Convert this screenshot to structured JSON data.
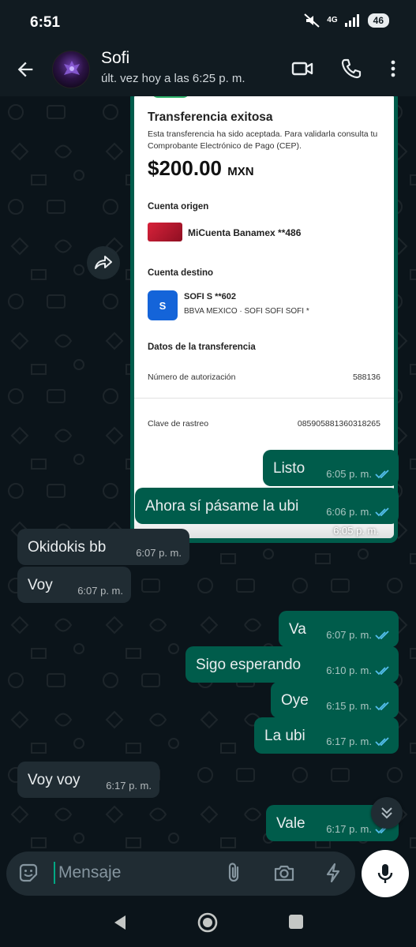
{
  "status_bar": {
    "time": "6:51",
    "network": "4G",
    "battery": "46"
  },
  "header": {
    "contact_name": "Sofi",
    "last_seen": "últ. vez hoy a las 6:25 p. m.",
    "icons": [
      "back-arrow-icon",
      "video-call-icon",
      "phone-icon",
      "more-vertical-icon"
    ]
  },
  "receipt": {
    "title": "Transferencia exitosa",
    "description": "Esta transferencia ha sido aceptada. Para validarla consulta tu Comprobante Electrónico de Pago (CEP).",
    "amount": "$200.00",
    "currency": "MXN",
    "origin_label": "Cuenta origen",
    "origin_account": "MiCuenta Banamex **486",
    "dest_label": "Cuenta destino",
    "dest_logo": "S",
    "dest_name": "SOFI S **602",
    "dest_detail": "BBVA MEXICO · SOFI SOFI SOFI *",
    "details_label": "Datos de la transferencia",
    "auth_label": "Número de autorización",
    "auth_value": "588136",
    "tracking_label": "Clave de rastreo",
    "tracking_value": "085905881360318265",
    "time": "6:05 p. m."
  },
  "messages": [
    {
      "dir": "out",
      "text": "Listo",
      "time": "6:05 p. m."
    },
    {
      "dir": "out",
      "text": "Ahora sí pásame la ubi",
      "time": "6:06 p. m."
    },
    {
      "dir": "in",
      "text": "Okidokis bb",
      "time": "6:07 p. m."
    },
    {
      "dir": "in",
      "text": "Voy",
      "time": "6:07 p. m."
    },
    {
      "dir": "out",
      "text": "Va",
      "time": "6:07 p. m."
    },
    {
      "dir": "out",
      "text": "Sigo esperando",
      "time": "6:10 p. m."
    },
    {
      "dir": "out",
      "text": "Oye",
      "time": "6:15 p. m."
    },
    {
      "dir": "out",
      "text": "La ubi",
      "time": "6:17 p. m."
    },
    {
      "dir": "in",
      "text": "Voy voy",
      "time": "6:17 p. m."
    },
    {
      "dir": "out",
      "text": "Vale",
      "time": "6:17 p. m."
    }
  ],
  "input": {
    "placeholder": "Mensaje"
  },
  "colors": {
    "outgoing_bubble": "#005c4b",
    "incoming_bubble": "#202c33",
    "read_ticks": "#53bdeb",
    "background": "#0b141a"
  }
}
